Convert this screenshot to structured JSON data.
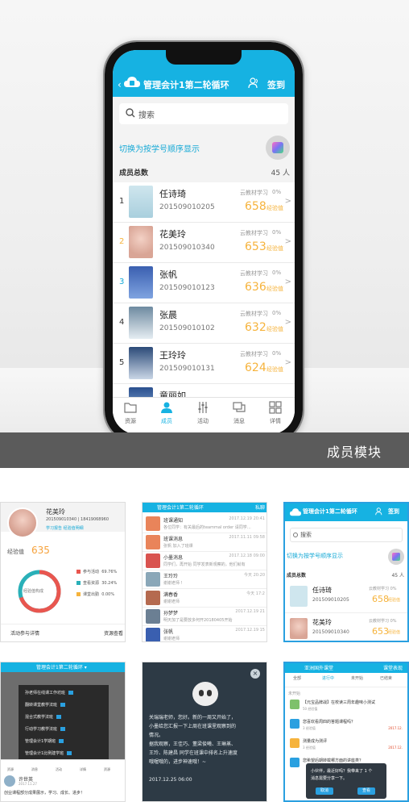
{
  "hero": {
    "banner_label": "成员模块",
    "app": {
      "back_glyph": "‹",
      "title": "管理会计1第二轮循环",
      "signin": "签到",
      "search_placeholder": "搜索",
      "switch_text": "切换为按学号顺序显示",
      "members_label": "成员总数",
      "members_count": "45 人",
      "members": [
        {
          "rank": "1",
          "name": "任诗琦",
          "id": "201509010205",
          "study": "云教材学习",
          "pct": "0%",
          "exp": "658",
          "exp_label": "经验值",
          "rank_color": "#333333"
        },
        {
          "rank": "2",
          "name": "花美玲",
          "id": "201509010340",
          "study": "云教材学习",
          "pct": "0%",
          "exp": "653",
          "exp_label": "经验值",
          "rank_color": "#f6b33c"
        },
        {
          "rank": "3",
          "name": "张帆",
          "id": "201509010123",
          "study": "云教材学习",
          "pct": "0%",
          "exp": "636",
          "exp_label": "经验值",
          "rank_color": "#16a9d6"
        },
        {
          "rank": "4",
          "name": "张晨",
          "id": "201509010102",
          "study": "云教材学习",
          "pct": "0%",
          "exp": "632",
          "exp_label": "经验值",
          "rank_color": "#333333"
        },
        {
          "rank": "5",
          "name": "王玲玲",
          "id": "201509010131",
          "study": "云教材学习",
          "pct": "0%",
          "exp": "624",
          "exp_label": "经验值",
          "rank_color": "#333333"
        },
        {
          "rank": "",
          "name": "童丽如",
          "id": "",
          "study": "",
          "pct": "",
          "exp": "",
          "exp_label": "",
          "rank_color": "#333333"
        }
      ],
      "tabs": [
        {
          "label": "资源",
          "icon": "folder-icon",
          "active": false
        },
        {
          "label": "成员",
          "icon": "person-icon",
          "active": true
        },
        {
          "label": "活动",
          "icon": "sliders-icon",
          "active": false
        },
        {
          "label": "消息",
          "icon": "chat-icon",
          "active": false
        },
        {
          "label": "详情",
          "icon": "grid-icon",
          "active": false
        }
      ]
    }
  },
  "thumb_profile": {
    "name": "花美玲",
    "id_line": "201509010340 | 18419068960",
    "actions": "学习报告   经验值明细",
    "exp_label": "经验值",
    "exp_value": "635",
    "ring_label": "经验值构成",
    "legend": [
      {
        "label": "参与活动",
        "value": "69.76%",
        "color": "#e9564f"
      },
      {
        "label": "查看资源",
        "value": "30.24%",
        "color": "#2ab0b8"
      },
      {
        "label": "课堂出勤",
        "value": "0.00%",
        "color": "#f6b33c"
      }
    ],
    "footer_left": "活动参与详情",
    "footer_right": "资源查看"
  },
  "thumb_messages": {
    "title": "管理会计1第二轮循环",
    "right": "私聊",
    "rows": [
      {
        "title": "班课通知",
        "sub": "各位同学：有关最后的teammal order 请同学…",
        "date": "2017.12.19 20:41",
        "color": "#e9845a"
      },
      {
        "title": "班课消息",
        "sub": "张帆 加入了班课",
        "date": "2017.11.11 09:58",
        "color": "#e9845a"
      },
      {
        "title": "小墨消息",
        "sub": "同学们，再开始 同学发表新观察的，他们就有",
        "date": "2017.12.18 09:00",
        "color": "#d9534f"
      },
      {
        "title": "王玲玲",
        "sub": "谢谢老师 !",
        "date": "今天 20:20",
        "color": "#8aa7b8"
      },
      {
        "title": "满春香",
        "sub": "谢谢老师",
        "date": "今天 17:2",
        "color": "#b56a4f"
      },
      {
        "title": "孙梦梦",
        "sub": "明天加了是要放多何开20180405开始",
        "date": "2017.12.19 21",
        "color": "#6b7f93"
      },
      {
        "title": "张帆",
        "sub": "谢谢老师",
        "date": "2017.12.19 15",
        "color": "#3a5fb0"
      }
    ]
  },
  "thumb_members": {
    "title": "管理会计1第二轮循环",
    "signin": "签到",
    "search": "搜索",
    "switch": "切换为按学号顺序显示",
    "members_label": "成员总数",
    "members_count": "45 人",
    "rows": [
      {
        "name": "任诗琦",
        "id": "201509010205",
        "study": "云教材学习 0%",
        "exp": "658",
        "exp_label": "经验值"
      },
      {
        "name": "花美玲",
        "id": "201509010340",
        "study": "云教材学习 0%",
        "exp": "653",
        "exp_label": "经验值"
      }
    ]
  },
  "thumb_dropdown": {
    "title": "管理会计1第二轮循环 ▾",
    "menu": [
      "孙老师在线课工作坊班",
      "翻转课堂教学法班",
      "混合式教学法班",
      "行动学习教学法班",
      "管理会计1学期班",
      "管理会计1比例建学班"
    ],
    "tabs": [
      "资源",
      "消息",
      "活动",
      "详情",
      "资源"
    ],
    "post_name": "许世英",
    "post_date": "2017.11.27",
    "post_content": "创业课程部分成果展示，学习、成长、进步！"
  },
  "thumb_dialog": {
    "close": "×",
    "lines": [
      "关瑞瑞老师，您好。新的一周又开始了，",
      "小墨给您汇报一下上周在班课里观察到的",
      "情况。",
      "据我观察，王佳巧、董梁俊曦、王琳蒸、",
      "王玲、陈建昌 同学在班课中排名上升速度",
      "哦喔哦的，进步神速哦！~",
      "",
      "2017.12.25 06:00"
    ]
  },
  "thumb_activities": {
    "title": "亚洲国外课堂",
    "right": "课堂表现",
    "tabs": [
      "全部",
      "进行中",
      "未开始",
      "已结束"
    ],
    "section": "未开始",
    "items": [
      {
        "title": "【元宝品牌战】在校读三周年趣味小测试",
        "sub": "50 经验值",
        "right": "",
        "color": "#7ec16b"
      },
      {
        "title": "您喜欢看周四的答题课程吗？",
        "sub": "3 经验值",
        "right": "2017.12.",
        "color": "#2aa0e0"
      },
      {
        "title": "测量成为测评",
        "sub": "3 经验值",
        "right": "2017.12.",
        "color": "#f6b33c"
      },
      {
        "title": "您希望后期转载哪方面的讲座类？",
        "sub": "",
        "right": "",
        "color": "#2aa0e0"
      }
    ],
    "popup_lines": [
      "小伙伴，最近好吗？我带来了 1 个",
      "消息需要分享一下。"
    ],
    "popup_buttons": [
      "取消",
      "查看"
    ]
  }
}
